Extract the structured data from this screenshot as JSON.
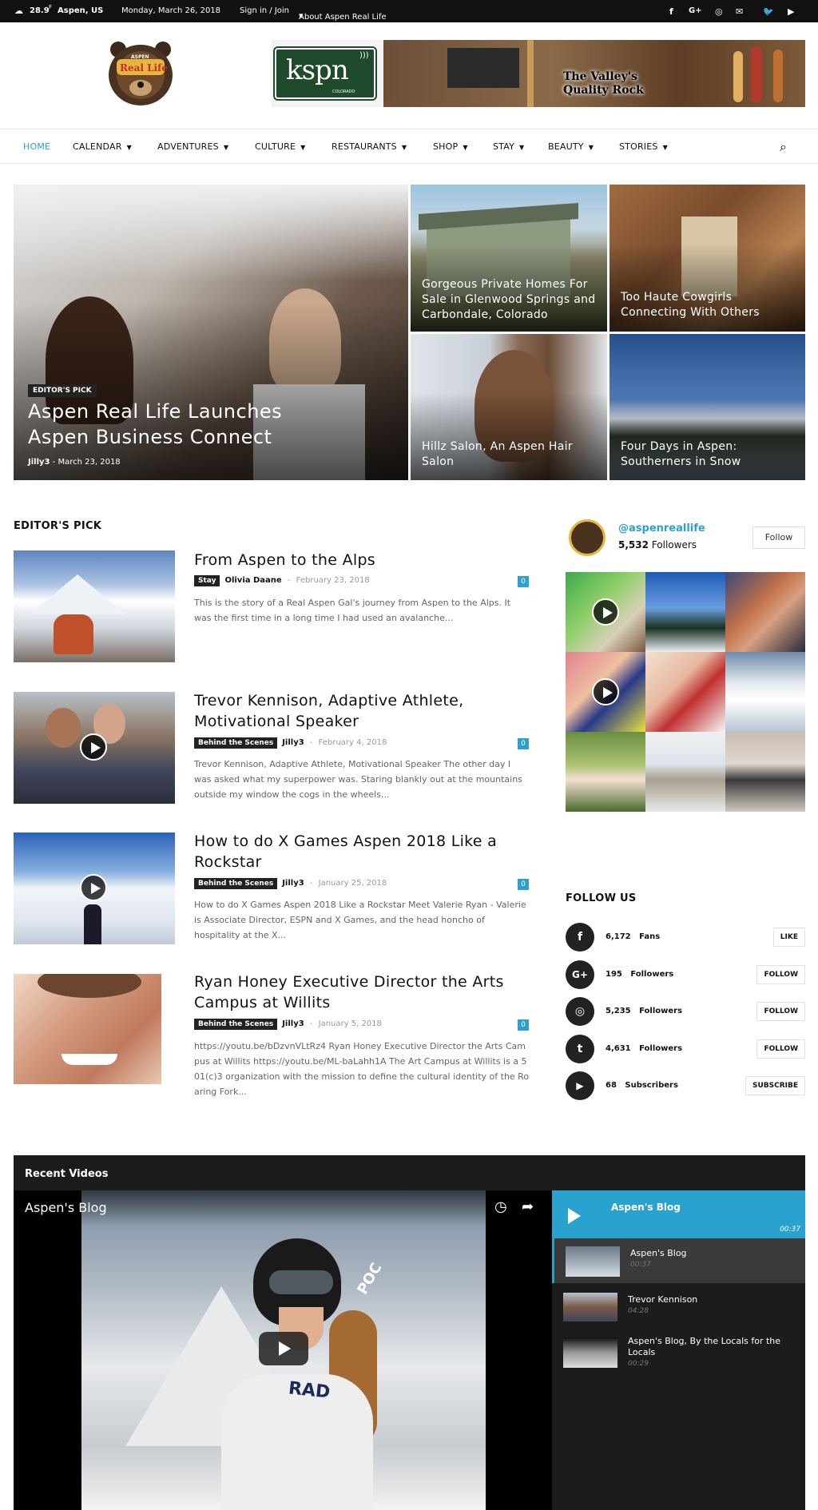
{
  "topbar": {
    "temperature": "28.9",
    "temp_unit": "F",
    "location": "Aspen, US",
    "date": "Monday, March 26, 2018",
    "signin": "Sign in / Join",
    "about": "About Aspen Real Life"
  },
  "header": {
    "logo_text": "Real Life",
    "logo_top": "ASPEN",
    "ad_brand": "kspn",
    "ad_brand_sub": "COLORADO",
    "ad_tagline_1": "The Valley's",
    "ad_tagline_2": "Quality Rock"
  },
  "nav": {
    "items": [
      "HOME",
      "CALENDAR",
      "ADVENTURES",
      "CULTURE",
      "RESTAURANTS",
      "SHOP",
      "STAY",
      "BEAUTY",
      "STORIES"
    ]
  },
  "hero": {
    "main": {
      "badge": "EDITOR'S PICK",
      "title": "Aspen Real Life Launches Aspen Business Connect",
      "author": "Jilly3",
      "date": "March 23, 2018"
    },
    "tiles": [
      {
        "title": "Gorgeous Private Homes For Sale in Glenwood Springs and Carbondale, Colorado"
      },
      {
        "title": "Too Haute Cowgirls Connecting With Others"
      },
      {
        "title": "Hillz Salon, An Aspen Hair Salon"
      },
      {
        "title": "Four Days in Aspen: Southerners in Snow"
      }
    ]
  },
  "editors_pick": {
    "heading": "EDITOR'S PICK",
    "posts": [
      {
        "title": "From Aspen to the Alps",
        "category": "Stay",
        "author": "Olivia Daane",
        "date": "February 23, 2018",
        "comments": "0",
        "excerpt": "This is the story of a Real Aspen Gal's journey from Aspen to the Alps.  It was the first time in a long time I had used an avalanche..."
      },
      {
        "title": "Trevor Kennison, Adaptive Athlete, Motivational Speaker",
        "category": "Behind the Scenes",
        "author": "Jilly3",
        "date": "February 4, 2018",
        "comments": "0",
        "excerpt": "Trevor Kennison, Adaptive Athlete, Motivational Speaker The other day I was asked what my superpower was. Staring blankly out at the mountains outside my window the cogs in the wheels..."
      },
      {
        "title": "How to do X Games Aspen 2018 Like a Rockstar",
        "category": "Behind the Scenes",
        "author": "Jilly3",
        "date": "January 25, 2018",
        "comments": "0",
        "excerpt": "How to do X Games Aspen 2018 Like a Rockstar Meet Valerie Ryan - Valerie is Associate Director, ESPN and X Games, and the head honcho of hospitality at the X..."
      },
      {
        "title": "Ryan Honey Executive Director the Arts Campus at Willits",
        "category": "Behind the Scenes",
        "author": "Jilly3",
        "date": "January 5, 2018",
        "comments": "0",
        "excerpt": "https://youtu.be/bDzvnVLtRz4 Ryan Honey Executive Director the Arts Campus at Willits https://youtu.be/ML-baLahh1A The Art Campus at Willits is a 501(c)3 organization with the mission to define the cultural identity of the Roaring Fork..."
      }
    ]
  },
  "instagram": {
    "handle": "@aspenreallife",
    "followers_count": "5,532",
    "followers_label": "Followers",
    "follow_button": "Follow"
  },
  "follow_us": {
    "heading": "FOLLOW US",
    "rows": [
      {
        "icon": "facebook-icon",
        "glyph": "f",
        "count": "6,172",
        "label": "Fans",
        "button": "LIKE"
      },
      {
        "icon": "google-plus-icon",
        "glyph": "G+",
        "count": "195",
        "label": "Followers",
        "button": "FOLLOW"
      },
      {
        "icon": "instagram-icon",
        "glyph": "◎",
        "count": "5,235",
        "label": "Followers",
        "button": "FOLLOW"
      },
      {
        "icon": "twitter-icon",
        "glyph": "t",
        "count": "4,631",
        "label": "Followers",
        "button": "FOLLOW"
      },
      {
        "icon": "youtube-icon",
        "glyph": "▶",
        "count": "68",
        "label": "Subscribers",
        "button": "SUBSCRIBE"
      }
    ]
  },
  "recent_videos": {
    "heading": "Recent Videos",
    "player_title": "Aspen's Blog",
    "playlist_title": "Aspen's Blog",
    "playlist_duration": "00:37",
    "items": [
      {
        "title": "Aspen's Blog",
        "duration": "00:37"
      },
      {
        "title": "Trevor Kennison",
        "duration": "04:28"
      },
      {
        "title": "Aspen's Blog, By the Locals for the Locals",
        "duration": "00:29"
      }
    ],
    "shirt_text": "RAD",
    "helmet_text": "POC"
  },
  "colors": {
    "accent": "#2f9fd0",
    "dark": "#111111"
  }
}
